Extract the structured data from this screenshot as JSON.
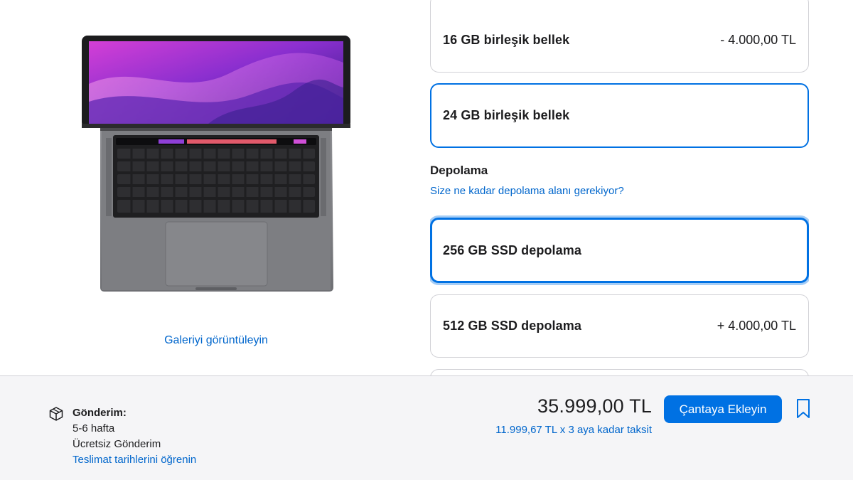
{
  "gallery": {
    "link_label": "Galeriyi görüntüleyin",
    "image_icon": "macbook-pro-image"
  },
  "options": {
    "memory": [
      {
        "label": "16 GB birleşik bellek",
        "price": "- 4.000,00 TL"
      },
      {
        "label": "24 GB birleşik bellek",
        "price": ""
      }
    ],
    "storage_title": "Depolama",
    "storage_help": "Size ne kadar depolama alanı gerekiyor?",
    "storage": [
      {
        "label": "256 GB SSD depolama",
        "price": ""
      },
      {
        "label": "512 GB SSD depolama",
        "price": "+ 4.000,00 TL"
      }
    ]
  },
  "footer": {
    "shipping_icon": "box-icon",
    "shipping_title": "Gönderim:",
    "shipping_time": "5-6 hafta",
    "shipping_cost": "Ücretsiz Gönderim",
    "delivery_link": "Teslimat tarihlerini öğrenin",
    "total_price": "35.999,00 TL",
    "installment": "11.999,67 TL x 3 aya kadar taksit",
    "add_to_bag": "Çantaya Ekleyin",
    "bookmark_icon": "bookmark-icon"
  },
  "colors": {
    "accent": "#0071e3",
    "link": "#0066cc",
    "footer_bg": "#f5f5f7"
  }
}
